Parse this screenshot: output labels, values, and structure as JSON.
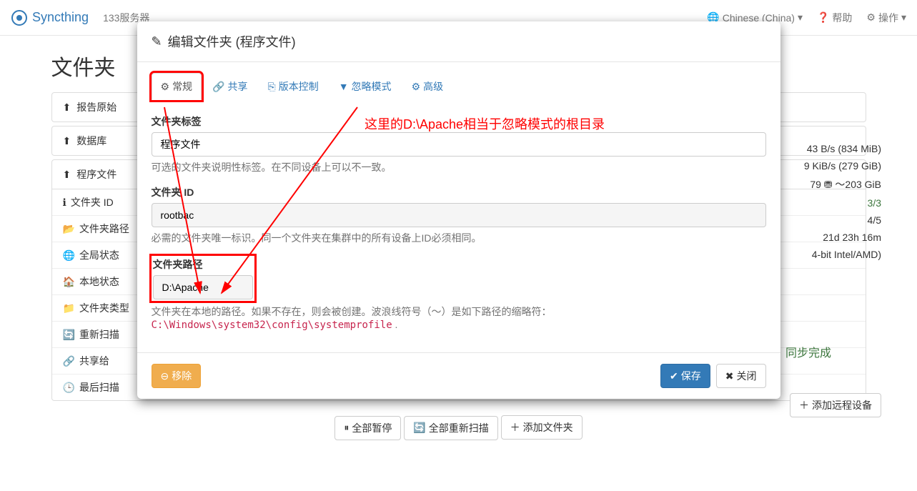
{
  "navbar": {
    "brand": "Syncthing",
    "server_name": "133服务器",
    "language": "Chinese (China)",
    "help": "帮助",
    "actions": "操作"
  },
  "page": {
    "folders_heading": "文件夹",
    "rows": [
      {
        "icon": "upload",
        "label": "报告原始"
      },
      {
        "icon": "upload",
        "label": "数据库"
      },
      {
        "icon": "upload",
        "label": "程序文件"
      }
    ],
    "details": [
      {
        "icon": "info",
        "label": "文件夹 ID"
      },
      {
        "icon": "folder-open",
        "label": "文件夹路径"
      },
      {
        "icon": "globe",
        "label": "全局状态"
      },
      {
        "icon": "home",
        "label": "本地状态"
      },
      {
        "icon": "folder",
        "label": "文件夹类型"
      },
      {
        "icon": "refresh",
        "label": "重新扫描"
      },
      {
        "icon": "share",
        "label": "共享给"
      },
      {
        "icon": "clock",
        "label": "最后扫描"
      }
    ],
    "footer_buttons": {
      "pause_all": "全部暂停",
      "rescan_all": "全部重新扫描",
      "add_folder": "添加文件夹"
    },
    "sync_done": "同步完成",
    "add_remote": "添加远程设备"
  },
  "right_stats": {
    "l1": "43 B/s (834 MiB)",
    "l2": "9 KiB/s (279 GiB)",
    "l3a": "79",
    "l3b": "～203 GiB",
    "l4": "3/3",
    "l5": "4/5",
    "l6": "21d 23h 16m",
    "l7": "4-bit Intel/AMD)"
  },
  "modal": {
    "title": "编辑文件夹 (程序文件)",
    "tabs": {
      "general": "常规",
      "sharing": "共享",
      "versioning": "版本控制",
      "ignore": "忽略模式",
      "advanced": "高级"
    },
    "form": {
      "label_title": "文件夹标签",
      "label_value": "程序文件",
      "label_help": "可选的文件夹说明性标签。在不同设备上可以不一致。",
      "id_title": "文件夹 ID",
      "id_value": "rootbac",
      "id_help": "必需的文件夹唯一标识。同一个文件夹在集群中的所有设备上ID必须相同。",
      "path_title": "文件夹路径",
      "path_value": "D:\\Apache",
      "path_help_1": "文件夹在本地的路径。如果不存在，则会被创建。波浪线符号（～）是如下路径的缩略符：",
      "path_help_2": "C:\\Windows\\system32\\config\\systemprofile"
    },
    "footer": {
      "remove": "移除",
      "save": "保存",
      "close": "关闭"
    }
  },
  "annotation": {
    "text": "这里的D:\\Apache相当于忽略模式的根目录"
  }
}
